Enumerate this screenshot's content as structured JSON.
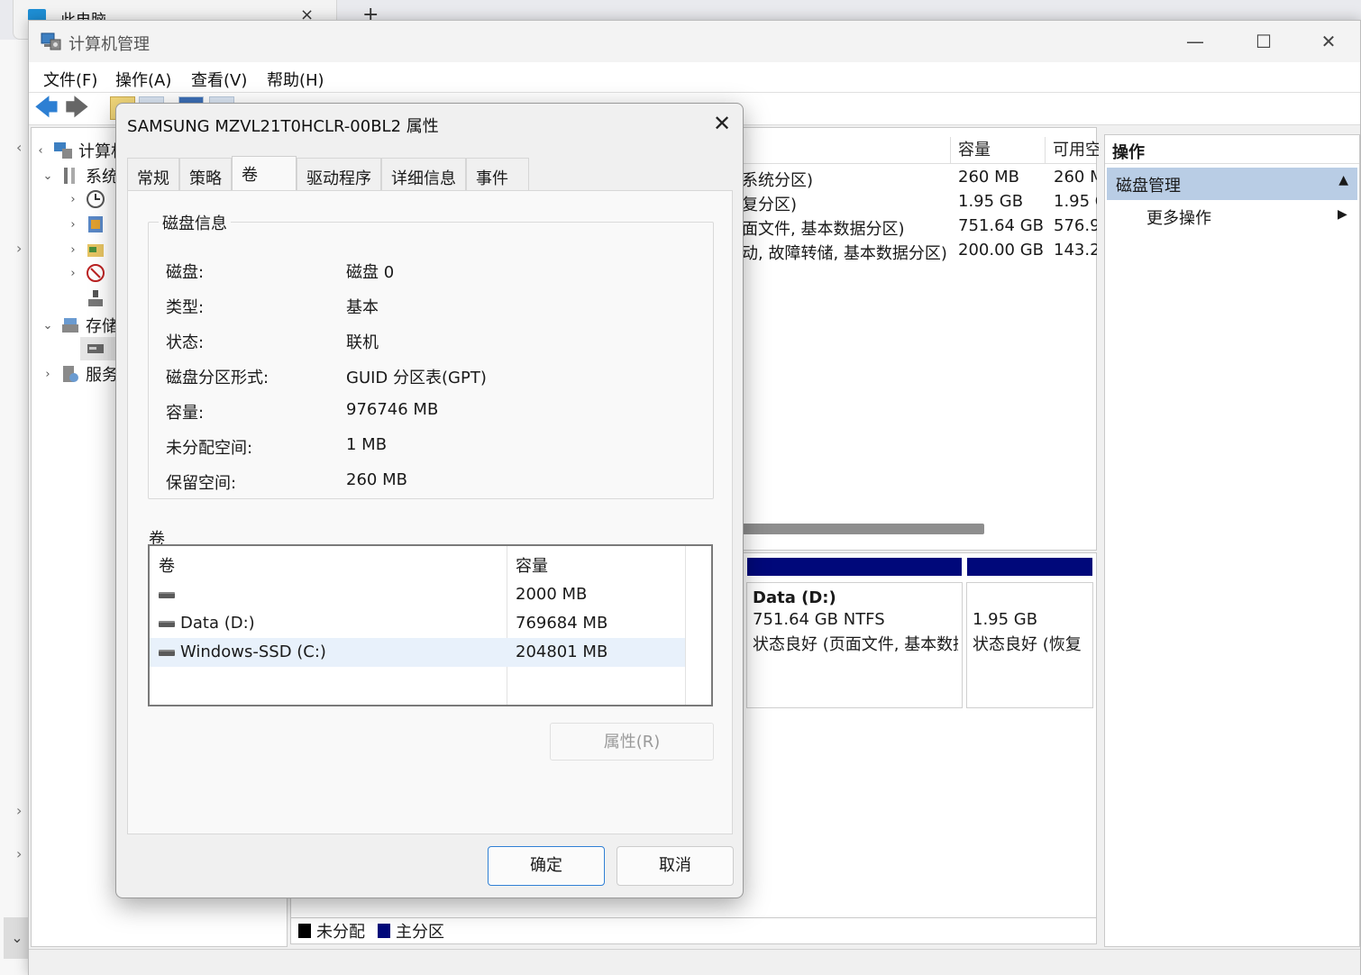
{
  "explorer": {
    "tab_title": "此电脑",
    "tab_close": "×",
    "new_tab": "+"
  },
  "window": {
    "title": "计算机管理",
    "minimize": "—",
    "maximize": "☐",
    "close": "✕"
  },
  "menu": [
    "文件(F)",
    "操作(A)",
    "查看(V)",
    "帮助(H)"
  ],
  "tree": [
    {
      "label": "计算机管"
    },
    {
      "label": "系统"
    },
    {
      "label": "存储"
    },
    {
      "label": "服务"
    }
  ],
  "list": {
    "columns": [
      "容量",
      "可用空"
    ],
    "rows": [
      {
        "layout": "系统分区)",
        "capacity": "260 MB",
        "free": "260 M"
      },
      {
        "layout": "复分区)",
        "capacity": "1.95 GB",
        "free": "1.95 G"
      },
      {
        "layout": "面文件, 基本数据分区)",
        "capacity": "751.64 GB",
        "free": "576.9"
      },
      {
        "layout": "动, 故障转储, 基本数据分区)",
        "capacity": "200.00 GB",
        "free": "143.2"
      }
    ]
  },
  "graph": {
    "partitions": [
      {
        "name": "Data  (D:)",
        "size": "751.64 GB NTFS",
        "status": "状态良好 (页面文件, 基本数据"
      },
      {
        "name": "",
        "size": "1.95 GB",
        "status": "状态良好 (恢复"
      }
    ],
    "legend": [
      {
        "label": "未分配",
        "color": "#000000"
      },
      {
        "label": "主分区",
        "color": "#00087a"
      }
    ]
  },
  "actions": {
    "title": "操作",
    "group": "磁盘管理",
    "item": "更多操作"
  },
  "dialog": {
    "title": "SAMSUNG MZVL21T0HCLR-00BL2 属性",
    "close": "✕",
    "tabs": [
      "常规",
      "策略",
      "卷",
      "驱动程序",
      "详细信息",
      "事件"
    ],
    "active_tab": "卷",
    "disk_info_label": "磁盘信息",
    "info": [
      {
        "key": "磁盘:",
        "value": "磁盘 0"
      },
      {
        "key": "类型:",
        "value": "基本"
      },
      {
        "key": "状态:",
        "value": "联机"
      },
      {
        "key": "磁盘分区形式:",
        "value": "GUID 分区表(GPT)"
      },
      {
        "key": "容量:",
        "value": "976746 MB"
      },
      {
        "key": "未分配空间:",
        "value": "1 MB"
      },
      {
        "key": "保留空间:",
        "value": "260 MB"
      }
    ],
    "volumes_label": "卷",
    "volume_columns": [
      "卷",
      "容量"
    ],
    "volumes": [
      {
        "name": "",
        "capacity": "2000 MB"
      },
      {
        "name": "Data (D:)",
        "capacity": "769684 MB"
      },
      {
        "name": "Windows-SSD (C:)",
        "capacity": "204801 MB",
        "selected": true
      }
    ],
    "properties_button": "属性(R)",
    "ok_button": "确定",
    "cancel_button": "取消"
  }
}
